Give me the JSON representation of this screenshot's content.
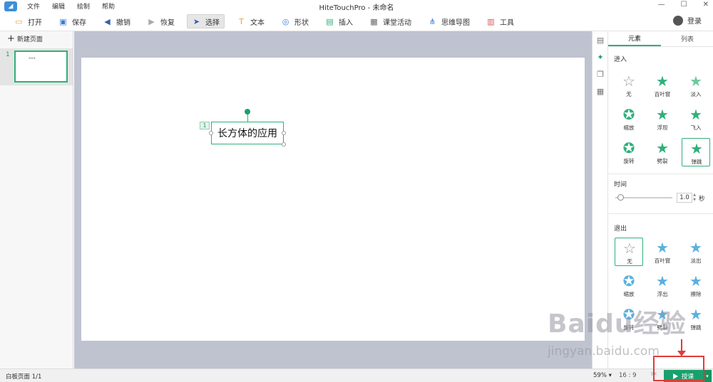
{
  "app": {
    "title": "HiteTouchPro - 未命名",
    "logo_glyph": "◢"
  },
  "menu": [
    "文件",
    "编辑",
    "绘制",
    "帮助"
  ],
  "window_controls": [
    "—",
    "☐",
    "✕"
  ],
  "toolbar": [
    {
      "label": "打开",
      "icon": "▭",
      "icon_name": "folder-icon",
      "color": "#e8a63a"
    },
    {
      "label": "保存",
      "icon": "▣",
      "icon_name": "save-icon",
      "color": "#3b7bd1"
    },
    {
      "label": "撤销",
      "icon": "◀",
      "icon_name": "undo-icon",
      "color": "#3b5fa8"
    },
    {
      "label": "恢复",
      "icon": "▶",
      "icon_name": "redo-icon",
      "color": "#aaaaaa"
    },
    {
      "label": "选择",
      "icon": "➤",
      "icon_name": "cursor-icon",
      "color": "#2f5db5",
      "active": true
    },
    {
      "label": "文本",
      "icon": "T",
      "icon_name": "text-icon",
      "color": "#e8a63a"
    },
    {
      "label": "形状",
      "icon": "◎",
      "icon_name": "shape-icon",
      "color": "#3b7bd1"
    },
    {
      "label": "插入",
      "icon": "▤",
      "icon_name": "insert-icon",
      "color": "#2fb07a"
    },
    {
      "label": "课堂活动",
      "icon": "▦",
      "icon_name": "activity-icon",
      "color": "#666666"
    },
    {
      "label": "思维导图",
      "icon": "⋔",
      "icon_name": "mindmap-icon",
      "color": "#3b7bd1"
    },
    {
      "label": "工具",
      "icon": "▥",
      "icon_name": "toolbox-icon",
      "color": "#d9534f"
    }
  ],
  "login_label": "登录",
  "left_panel": {
    "new_page_label": "新建页面",
    "page_number": "1",
    "thumb_text": "---"
  },
  "slide": {
    "text": "长方体的应用",
    "anim_badge": "1"
  },
  "right_panel": {
    "tabs": [
      "元素",
      "列表"
    ],
    "enter_title": "进入",
    "enter_effects": [
      {
        "label": "无",
        "glyph": "☆",
        "color": "#999999"
      },
      {
        "label": "百叶窗",
        "glyph": "★",
        "color": "#2fb07a"
      },
      {
        "label": "淡入",
        "glyph": "★",
        "color": "#6cc99e"
      },
      {
        "label": "缩放",
        "glyph": "✪",
        "color": "#2fb07a"
      },
      {
        "label": "浮现",
        "glyph": "★",
        "color": "#2fb07a"
      },
      {
        "label": "飞入",
        "glyph": "★",
        "color": "#2fb07a"
      },
      {
        "label": "旋转",
        "glyph": "✪",
        "color": "#2fb07a"
      },
      {
        "label": "劈裂",
        "glyph": "★",
        "color": "#2fb07a"
      },
      {
        "label": "弹跳",
        "glyph": "★",
        "color": "#2fb07a",
        "selected": true
      }
    ],
    "time_label": "时间",
    "time_value": "1.0",
    "time_unit": "秒",
    "exit_title": "退出",
    "exit_effects": [
      {
        "label": "无",
        "glyph": "☆",
        "color": "#999999",
        "selected": true
      },
      {
        "label": "百叶窗",
        "glyph": "★",
        "color": "#5ab0de"
      },
      {
        "label": "淡出",
        "glyph": "★",
        "color": "#5ab0de"
      },
      {
        "label": "缩放",
        "glyph": "✪",
        "color": "#5ab0de"
      },
      {
        "label": "浮出",
        "glyph": "★",
        "color": "#5ab0de"
      },
      {
        "label": "擦除",
        "glyph": "★",
        "color": "#5ab0de"
      },
      {
        "label": "旋转",
        "glyph": "✪",
        "color": "#5ab0de"
      },
      {
        "label": "劈裂",
        "glyph": "★",
        "color": "#5ab0de"
      },
      {
        "label": "弹跳",
        "glyph": "★",
        "color": "#5ab0de"
      }
    ]
  },
  "side_tabs": [
    {
      "glyph": "▤",
      "name": "page-props-icon"
    },
    {
      "glyph": "✦",
      "name": "animation-icon"
    },
    {
      "glyph": "❐",
      "name": "layers-icon"
    },
    {
      "glyph": "▦",
      "name": "resources-icon"
    }
  ],
  "status": {
    "page_info": "白板页面 1/1",
    "zoom": "59%",
    "zoom_arrow": "▾",
    "ratio": "16 : 9",
    "teach_label": "授课",
    "teach_dropdown": "▾",
    "screenshot_glyph": "✂"
  },
  "watermark": {
    "brand": "Baidu经验",
    "url": "jingyan.baidu.com"
  }
}
